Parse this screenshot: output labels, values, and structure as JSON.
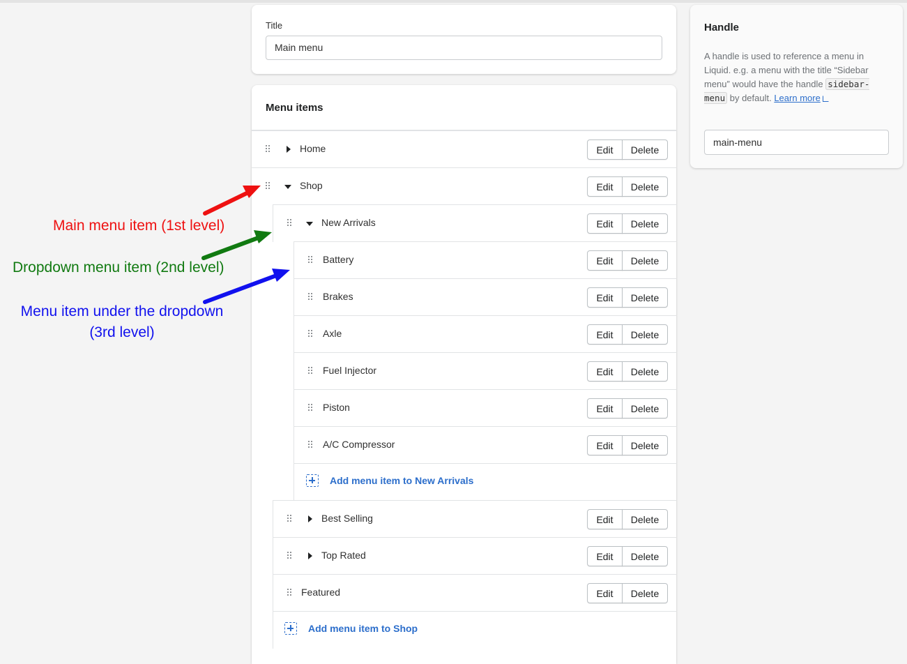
{
  "title_card": {
    "label": "Title",
    "value": "Main menu"
  },
  "menu": {
    "heading": "Menu items",
    "edit_label": "Edit",
    "delete_label": "Delete",
    "items": [
      {
        "label": "Home",
        "level": 1,
        "caret": "right"
      },
      {
        "label": "Shop",
        "level": 1,
        "caret": "down"
      },
      {
        "label": "New Arrivals",
        "level": 2,
        "caret": "down"
      },
      {
        "label": "Battery",
        "level": 3,
        "caret": "none"
      },
      {
        "label": "Brakes",
        "level": 3,
        "caret": "none"
      },
      {
        "label": "Axle",
        "level": 3,
        "caret": "none"
      },
      {
        "label": "Fuel Injector",
        "level": 3,
        "caret": "none"
      },
      {
        "label": "Piston",
        "level": 3,
        "caret": "none"
      },
      {
        "label": "A/C Compressor",
        "level": 3,
        "caret": "none"
      }
    ],
    "add_to_new_arrivals": "Add menu item to New Arrivals",
    "items_after": [
      {
        "label": "Best Selling",
        "level": 2,
        "caret": "right"
      },
      {
        "label": "Top Rated",
        "level": 2,
        "caret": "right"
      },
      {
        "label": "Featured",
        "level": 2,
        "caret": "none"
      }
    ],
    "add_to_shop": "Add menu item to Shop"
  },
  "handle_card": {
    "heading": "Handle",
    "desc_before": "A handle is used to reference a menu in Liquid. e.g. a menu with the title “Sidebar menu” would have the handle ",
    "code": "sidebar-menu",
    "desc_after": " by default. ",
    "link": "Learn more",
    "value": "main-menu"
  },
  "annotations": {
    "first": {
      "text": "Main menu item (1st level)",
      "color": "#ee1111"
    },
    "second": {
      "text": "Dropdown menu item (2nd level)",
      "color": "#117a11"
    },
    "third_line1": "Menu item under the dropdown",
    "third_line2": "(3rd level)",
    "third_color": "#1111ee"
  },
  "colors": {
    "link": "#2c6ecb",
    "background": "#f4f4f4"
  }
}
